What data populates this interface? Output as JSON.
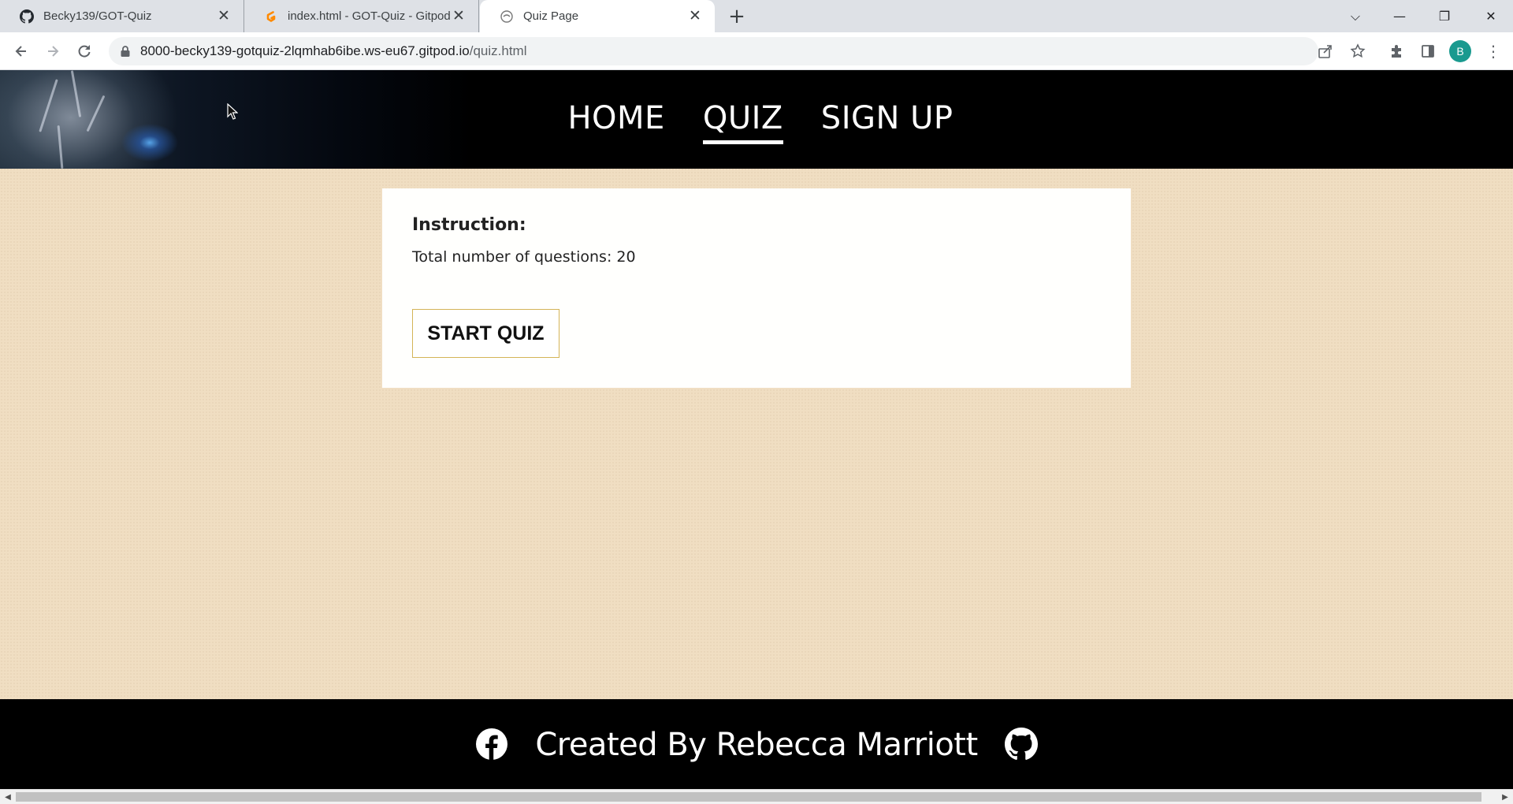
{
  "browser": {
    "tabs": [
      {
        "title": "Becky139/GOT-Quiz",
        "favicon": "github-icon",
        "active": false
      },
      {
        "title": "index.html - GOT-Quiz - Gitpod C",
        "favicon": "gitpod-icon",
        "active": false
      },
      {
        "title": "Quiz Page",
        "favicon": "page-icon",
        "active": true
      }
    ],
    "new_tab_symbol": "+",
    "close_symbol": "✕",
    "window_controls": {
      "dropdown": "⌵",
      "minimize": "—",
      "restore": "❐",
      "close": "✕"
    },
    "url_host": "8000-becky139-gotquiz-2lqmhab6ibe.ws-eu67.gitpod.io",
    "url_path": "/quiz.html",
    "profile_initial": "B",
    "menu_symbol": "⋮"
  },
  "site": {
    "nav": [
      {
        "label": "HOME",
        "current": false
      },
      {
        "label": "QUIZ",
        "current": true
      },
      {
        "label": "SIGN UP",
        "current": false
      }
    ],
    "quiz": {
      "heading": "Instruction:",
      "question_count_text": "Total number of questions: 20",
      "start_button_label": "START QUIZ"
    },
    "footer": {
      "text": "Created By Rebecca Marriott",
      "icons": [
        "facebook-icon",
        "github-icon"
      ]
    }
  },
  "colors": {
    "page_background": "#f0dec2",
    "header_background": "#000000",
    "card_background": "#fffffd",
    "button_border": "#d4b457",
    "profile_avatar": "#1a9a8f"
  }
}
